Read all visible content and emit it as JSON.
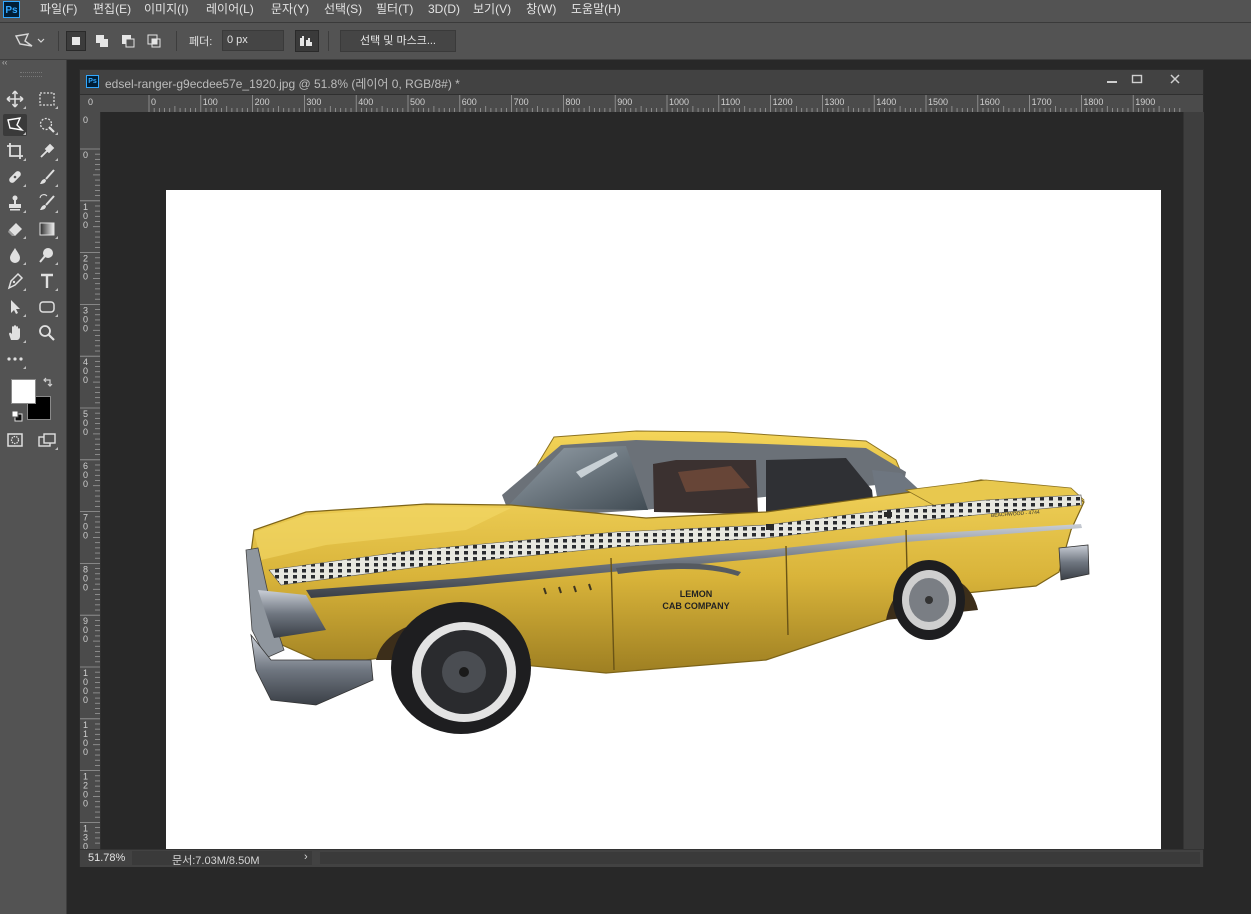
{
  "app": {
    "logo": "Ps"
  },
  "menu": [
    "파일(F)",
    "편집(E)",
    "이미지(I)",
    "레이어(L)",
    "문자(Y)",
    "선택(S)",
    "필터(T)",
    "3D(D)",
    "보기(V)",
    "창(W)",
    "도움말(H)"
  ],
  "options": {
    "feather_label": "페더:",
    "feather_value": "0 px",
    "select_and_mask": "선택 및 마스크..."
  },
  "tools": [
    "move-icon",
    "rect-marquee-icon",
    "polygonal-lasso-icon",
    "quick-selection-icon",
    "crop-icon",
    "eyedropper-icon",
    "healing-brush-icon",
    "brush-icon",
    "clone-stamp-icon",
    "history-brush-icon",
    "eraser-icon",
    "gradient-icon",
    "blur-icon",
    "dodge-icon",
    "pen-icon",
    "type-icon",
    "path-selection-icon",
    "rectangle-shape-icon",
    "hand-icon",
    "zoom-icon"
  ],
  "colors": {
    "foreground": "#ffffff",
    "background": "#000000",
    "ui_panel": "#535353",
    "pasteboard": "#282828"
  },
  "document": {
    "title": "edsel-ranger-g9ecdee57e_1920.jpg @ 51.8% (레이어 0, RGB/8#) *",
    "zoom": "51.78%",
    "size": "문서:7.03M/8.50M",
    "ruler_h": [
      "0",
      "0",
      "100",
      "200",
      "300",
      "400",
      "500",
      "600",
      "700",
      "800",
      "900",
      "1000",
      "1100",
      "1200",
      "1300",
      "1400",
      "1500",
      "1600",
      "1700",
      "1800",
      "1900"
    ],
    "ruler_v": [
      "0",
      "0",
      "100",
      "200",
      "300",
      "400",
      "500",
      "600",
      "700",
      "800",
      "900",
      "1000",
      "1100",
      "1200",
      "130"
    ],
    "car_text": {
      "line1": "LEMON",
      "line2": "CAB COMPANY",
      "plate": "BEACHWOOD - 4744"
    }
  }
}
